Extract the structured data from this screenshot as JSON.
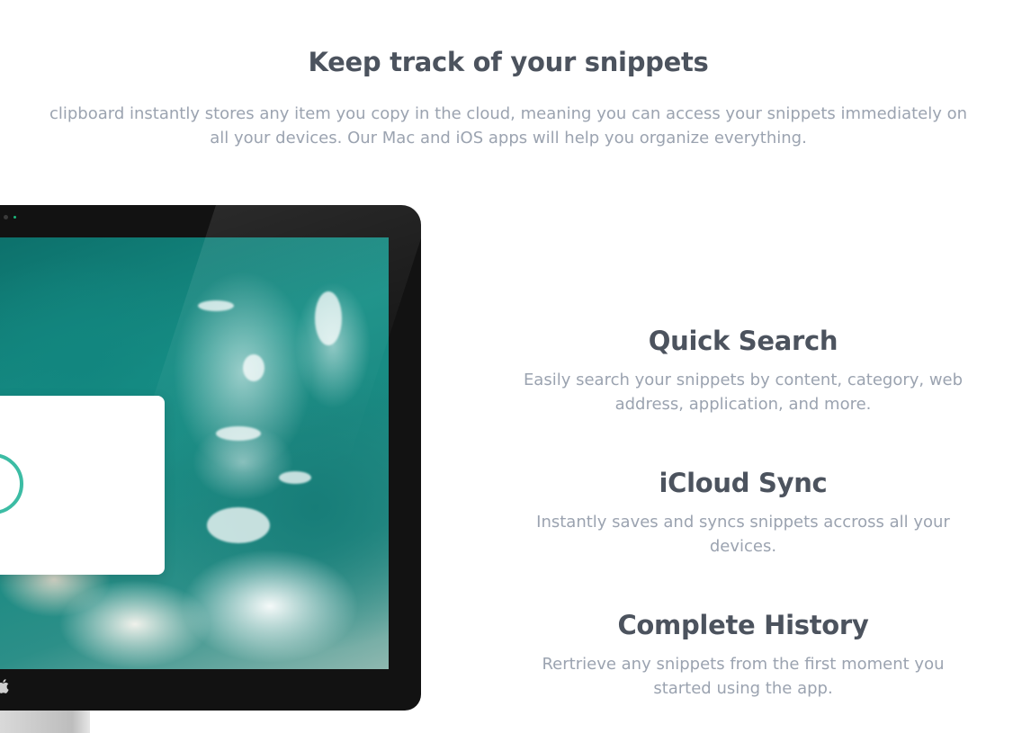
{
  "hero": {
    "title": "Keep track of your snippets",
    "description": "clipboard instantly stores any item you copy in the cloud, meaning you can access your snippets immediately on all your devices. Our Mac and iOS apps will help you organize everything."
  },
  "features": [
    {
      "title": "Quick Search",
      "description": "Easily search your snippets by content, category, web address, application, and more."
    },
    {
      "title": "iCloud Sync",
      "description": "Instantly saves and syncs snippets accross all your devices."
    },
    {
      "title": "Complete History",
      "description": "Rertrieve any snippets from the first moment you started using the app."
    }
  ],
  "illustration": {
    "device": "imac",
    "screen_icon": "check-circle-icon",
    "brand_icon": "apple-icon",
    "accent_color": "#3cbca4",
    "heading_color": "#4c535e",
    "body_color": "#9ba3b0"
  }
}
